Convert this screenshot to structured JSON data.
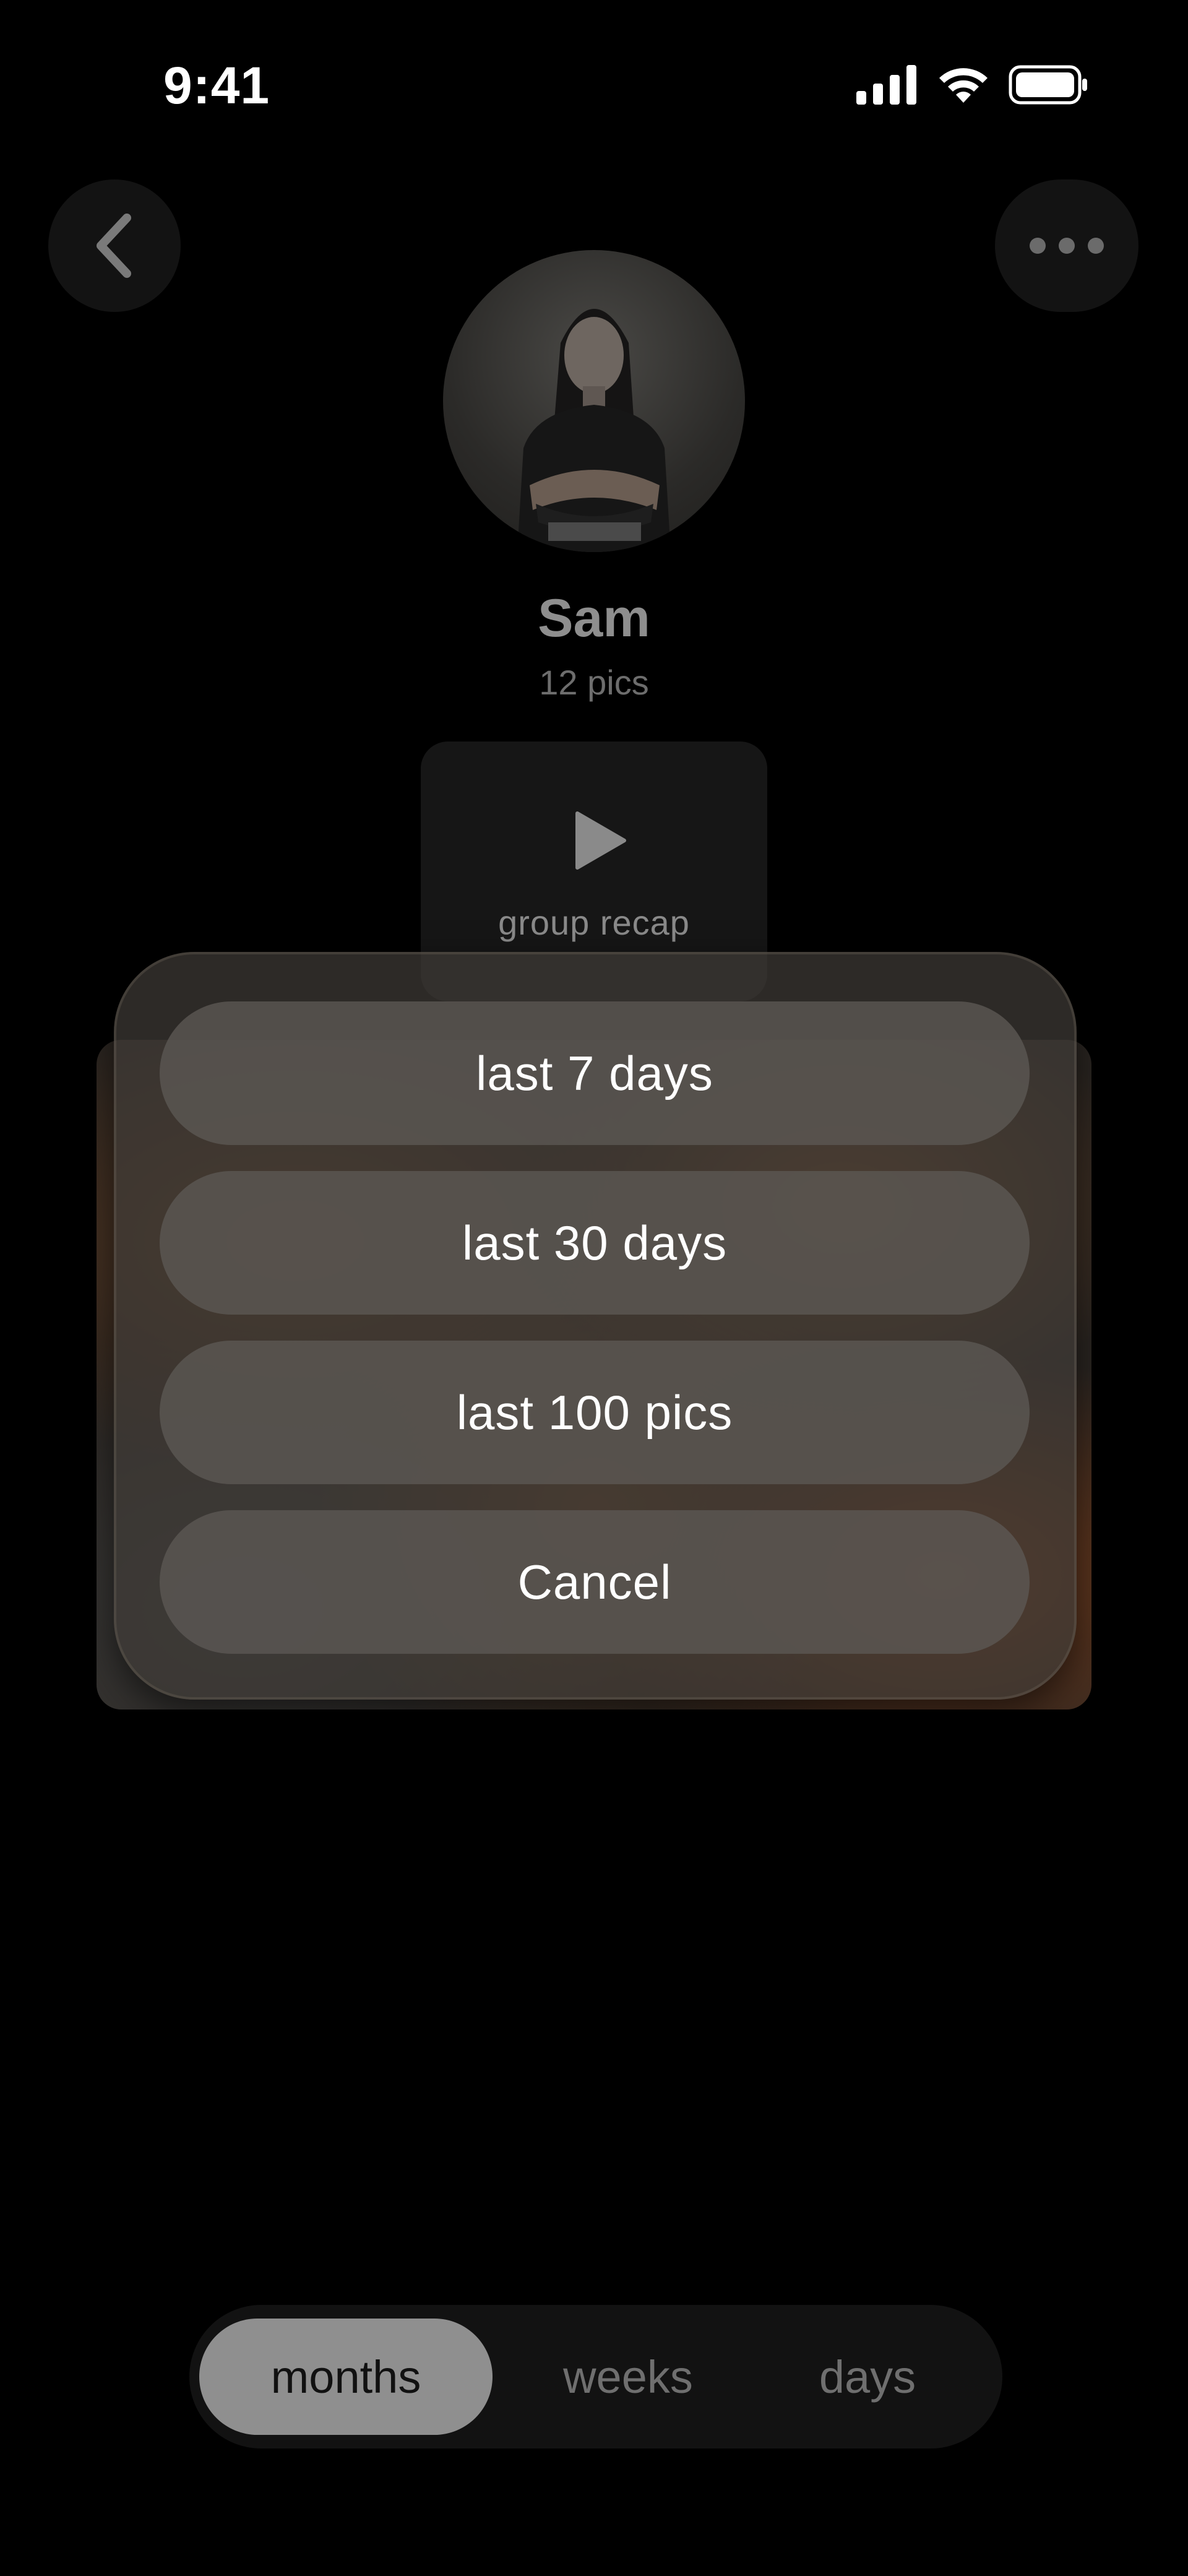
{
  "status_bar": {
    "time": "9:41"
  },
  "header": {
    "back_icon": "chevron-left-icon",
    "more_icon": "more-horizontal-icon"
  },
  "profile": {
    "name": "Sam",
    "count": "12 pics"
  },
  "recap": {
    "icon": "play-icon",
    "label": "group recap"
  },
  "action_sheet": {
    "options": [
      {
        "label": "last 7 days"
      },
      {
        "label": "last 30 days"
      },
      {
        "label": "last 100 pics"
      }
    ],
    "cancel_label": "Cancel"
  },
  "segmented": {
    "items": [
      {
        "label": "months",
        "selected": true
      },
      {
        "label": "weeks",
        "selected": false
      },
      {
        "label": "days",
        "selected": false
      }
    ]
  },
  "colors": {
    "background": "#000000",
    "sheet": "#3e3a36",
    "sheet_button": "#5c5854",
    "segment_active": "#8f8f8f"
  }
}
